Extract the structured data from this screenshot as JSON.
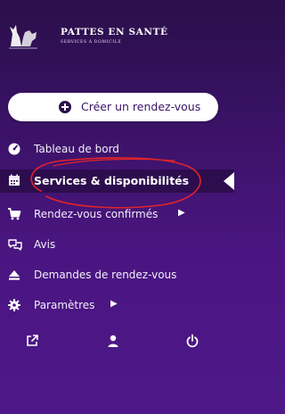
{
  "brand": {
    "title": "PATTES EN SANTÉ",
    "subtitle": "SERVICES À DOMICILE"
  },
  "create_button": {
    "label": "Créer un rendez-vous",
    "icon": "plus-circle-icon"
  },
  "menu": [
    {
      "label": "Tableau de bord",
      "icon": "dashboard-gauge-icon",
      "active": false
    },
    {
      "label": "Services & disponibilités",
      "icon": "calendar-icon",
      "active": true
    },
    {
      "label": "Rendez-vous confirmés",
      "icon": "cart-icon",
      "active": false,
      "has_submenu": true
    },
    {
      "label": "Avis",
      "icon": "chat-bubbles-icon",
      "active": false
    },
    {
      "label": "Demandes de rendez-vous",
      "icon": "eject-icon",
      "active": false
    },
    {
      "label": "Paramètres",
      "icon": "gear-icon",
      "active": false,
      "has_submenu": true
    }
  ],
  "bottom_icons": [
    "external-link-icon",
    "user-icon",
    "power-icon"
  ],
  "colors": {
    "sidebar_top": "#2a0f4a",
    "sidebar_bottom": "#4e1889",
    "active_background": "#2d0d4d",
    "annotation_circle": "#e0242a"
  }
}
